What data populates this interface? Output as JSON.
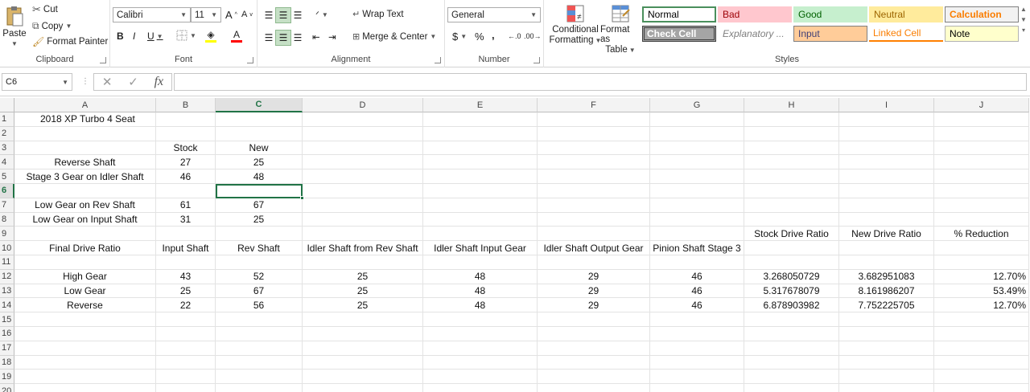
{
  "ribbon": {
    "clipboard": {
      "label": "Clipboard",
      "paste": "Paste",
      "cut": "Cut",
      "copy": "Copy",
      "format_painter": "Format Painter"
    },
    "font": {
      "label": "Font",
      "family": "Calibri",
      "size": "11",
      "grow": "A",
      "shrink": "A",
      "bold": "B",
      "italic": "I",
      "underline": "U",
      "font_color_glyph": "A"
    },
    "alignment": {
      "label": "Alignment",
      "wrap_text": "Wrap Text",
      "merge_center": "Merge & Center"
    },
    "number": {
      "label": "Number",
      "format": "General",
      "currency": "$",
      "percent": "%",
      "comma": ","
    },
    "styles": {
      "label": "Styles",
      "conditional_formatting_line1": "Conditional",
      "conditional_formatting_line2": "Formatting",
      "format_as_table_line1": "Format as",
      "format_as_table_line2": "Table",
      "gallery": [
        {
          "name": "Normal",
          "bg": "#ffffff",
          "fg": "#000000",
          "border": "#4a8f5c"
        },
        {
          "name": "Bad",
          "bg": "#ffc7ce",
          "fg": "#9c0006",
          "border": "#ffc7ce"
        },
        {
          "name": "Good",
          "bg": "#c6efce",
          "fg": "#006100",
          "border": "#c6efce"
        },
        {
          "name": "Neutral",
          "bg": "#ffeb9c",
          "fg": "#9c6500",
          "border": "#ffeb9c"
        },
        {
          "name": "Calculation",
          "bg": "#f2f2f2",
          "fg": "#fa7d00",
          "border": "#7f7f7f"
        },
        {
          "name": "Check Cell",
          "bg": "#a5a5a5",
          "fg": "#ffffff",
          "border": "#3f3f3f"
        },
        {
          "name": "Explanatory ...",
          "bg": "#ffffff",
          "fg": "#7f7f7f",
          "border": "#ffffff"
        },
        {
          "name": "Input",
          "bg": "#ffcc99",
          "fg": "#3f3f76",
          "border": "#7f7f7f"
        },
        {
          "name": "Linked Cell",
          "bg": "#ffffff",
          "fg": "#fa7d00",
          "border": "#ff8001"
        },
        {
          "name": "Note",
          "bg": "#ffffcc",
          "fg": "#000000",
          "border": "#b2b2b2"
        }
      ]
    }
  },
  "formula_bar": {
    "name_box": "C6",
    "cancel": "✕",
    "enter": "✓",
    "fx": "fx",
    "value": ""
  },
  "sheet": {
    "columns": [
      "A",
      "B",
      "C",
      "D",
      "E",
      "F",
      "G",
      "H",
      "I",
      "J"
    ],
    "selected_column": "C",
    "selected_row": "6",
    "rows": [
      "1",
      "2",
      "3",
      "4",
      "5",
      "6",
      "7",
      "8",
      "9",
      "10",
      "11",
      "12",
      "13",
      "14",
      "15",
      "16",
      "17",
      "18",
      "19",
      "20"
    ],
    "cells": {
      "A1": "2018 XP Turbo 4 Seat",
      "B3": "Stock",
      "C3": "New",
      "A4": "Reverse Shaft",
      "B4": "27",
      "C4": "25",
      "A5": "Stage 3 Gear on Idler Shaft",
      "B5": "46",
      "C5": "48",
      "A7": "Low Gear on Rev Shaft",
      "B7": "61",
      "C7": "67",
      "A8": "Low Gear on Input Shaft",
      "B8": "31",
      "C8": "25",
      "H9": "Stock Drive Ratio",
      "I9": "New Drive Ratio",
      "J9": "% Reduction",
      "A10": "Final Drive Ratio",
      "B10": "Input Shaft",
      "C10": "Rev Shaft",
      "D10": "Idler Shaft from Rev Shaft",
      "E10": "Idler Shaft Input Gear",
      "F10": "Idler Shaft Output Gear",
      "G10": "Pinion Shaft Stage 3",
      "A12": "High Gear",
      "B12": "43",
      "C12": "52",
      "D12": "25",
      "E12": "48",
      "F12": "29",
      "G12": "46",
      "H12": "3.268050729",
      "I12": "3.682951083",
      "J12": "12.70%",
      "A13": "Low Gear",
      "B13": "25",
      "C13": "67",
      "D13": "25",
      "E13": "48",
      "F13": "29",
      "G13": "46",
      "H13": "5.317678079",
      "I13": "8.161986207",
      "J13": "53.49%",
      "A14": "Reverse",
      "B14": "22",
      "C14": "56",
      "D14": "25",
      "E14": "48",
      "F14": "29",
      "G14": "46",
      "H14": "6.878903982",
      "I14": "7.752225705",
      "J14": "12.70%"
    },
    "right_aligned_cells": [
      "J12",
      "J13",
      "J14"
    ]
  },
  "colors": {
    "accent": "#217346",
    "selected_button": "#c6e0c6"
  }
}
